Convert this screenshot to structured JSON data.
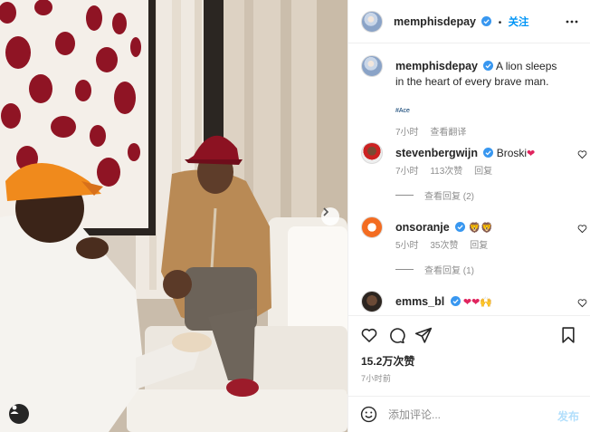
{
  "post": {
    "author": "memphisdepay",
    "follow_label": "关注",
    "separator": "•",
    "caption": "A lion sleeps in the heart of every brave man.",
    "hashtag": "#Ace",
    "caption_time": "7小时",
    "translate_label": "查看翻译",
    "likes": "15.2万次赞",
    "posted_ago": "7小时前"
  },
  "comments": [
    {
      "username": "stevenbergwijn",
      "text": "Broski",
      "emoji": "❤",
      "time": "7小时",
      "likes": "113次赞",
      "reply_label": "回复",
      "view_replies": "查看回复 (2)"
    },
    {
      "username": "onsoranje",
      "text": "",
      "emoji": "🦁🦁",
      "time": "5小时",
      "likes": "35次赞",
      "reply_label": "回复",
      "view_replies": "查看回复 (1)"
    },
    {
      "username": "emms_bl",
      "text": "",
      "emoji": "❤❤🙌"
    }
  ],
  "composer": {
    "placeholder": "添加评论...",
    "post_label": "发布"
  },
  "icons": {
    "header": [
      "verified-badge-icon",
      "more-options-icon"
    ],
    "actions": [
      "heart-icon",
      "comment-icon",
      "share-icon",
      "bookmark-icon"
    ],
    "media": [
      "next-arrow-icon",
      "user-tag-icon"
    ],
    "composer": [
      "emoji-icon"
    ]
  },
  "colors": {
    "accent": "#0095f6",
    "verified": "#3897f0",
    "muted": "#8e8e8e",
    "text": "#262626",
    "post_disabled": "#b2dffc",
    "heart_emoji": "#e0245e"
  }
}
